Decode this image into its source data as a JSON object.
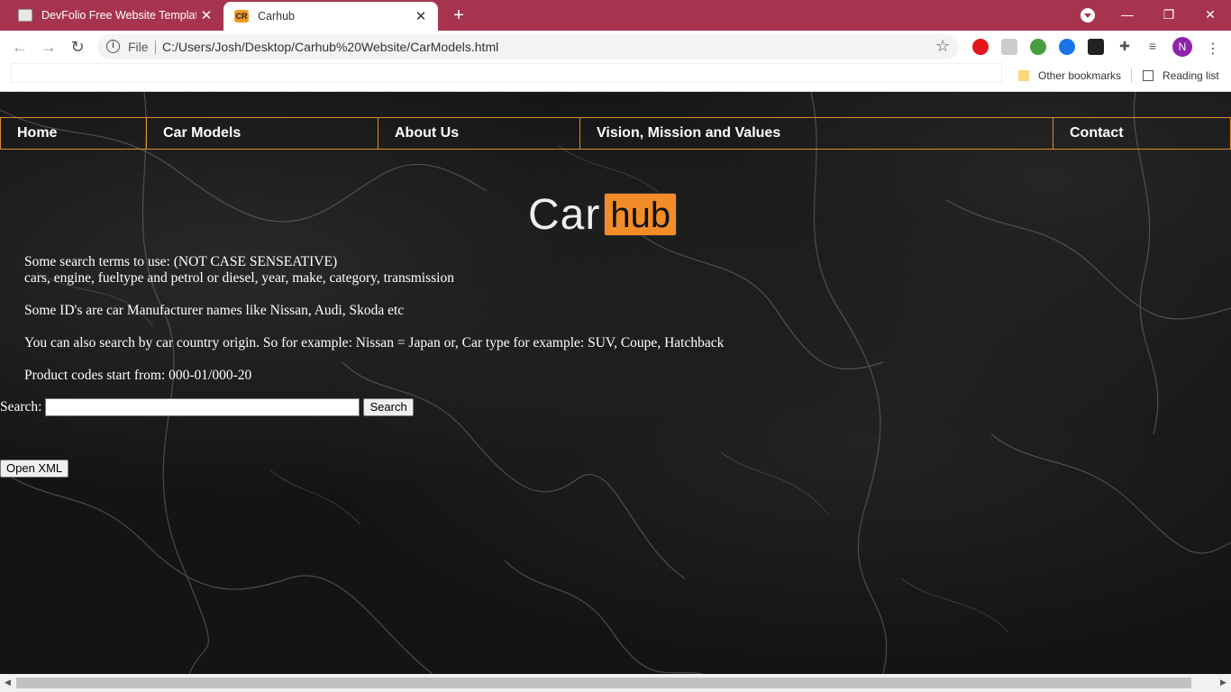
{
  "browser": {
    "tabs": [
      {
        "title": "DevFolio Free Website Template |",
        "active": false
      },
      {
        "title": "Carhub",
        "active": true,
        "favicon_text": "CR"
      }
    ],
    "address": {
      "scheme_label": "File",
      "url": "C:/Users/Josh/Desktop/Carhub%20Website/CarModels.html"
    },
    "bookmarks": {
      "other": "Other bookmarks",
      "reading_list": "Reading list"
    },
    "profile_initial": "N"
  },
  "nav": {
    "items": [
      "Home",
      "Car Models",
      "About Us",
      "Vision, Mission and Values",
      "Contact"
    ]
  },
  "logo": {
    "car": "Car",
    "hub": "hub"
  },
  "info": {
    "line1": "Some search terms to use: (NOT CASE SENSEATIVE)",
    "line2": "cars, engine, fueltype and petrol or diesel, year, make, category, transmission",
    "line3": "Some ID's are car Manufacturer names like Nissan, Audi, Skoda etc",
    "line4": "You can also search by car country origin. So for example: Nissan = Japan or, Car type for example: SUV, Coupe, Hatchback",
    "line5": "Product codes start from: 000-01/000-20"
  },
  "search": {
    "label": "Search:",
    "value": "",
    "button": "Search"
  },
  "xml_button": "Open XML",
  "colors": {
    "tabbar": "#a7344f",
    "nav_border": "#d98d2b",
    "logo_hub_bg": "#f28c28",
    "background": "#141414"
  }
}
